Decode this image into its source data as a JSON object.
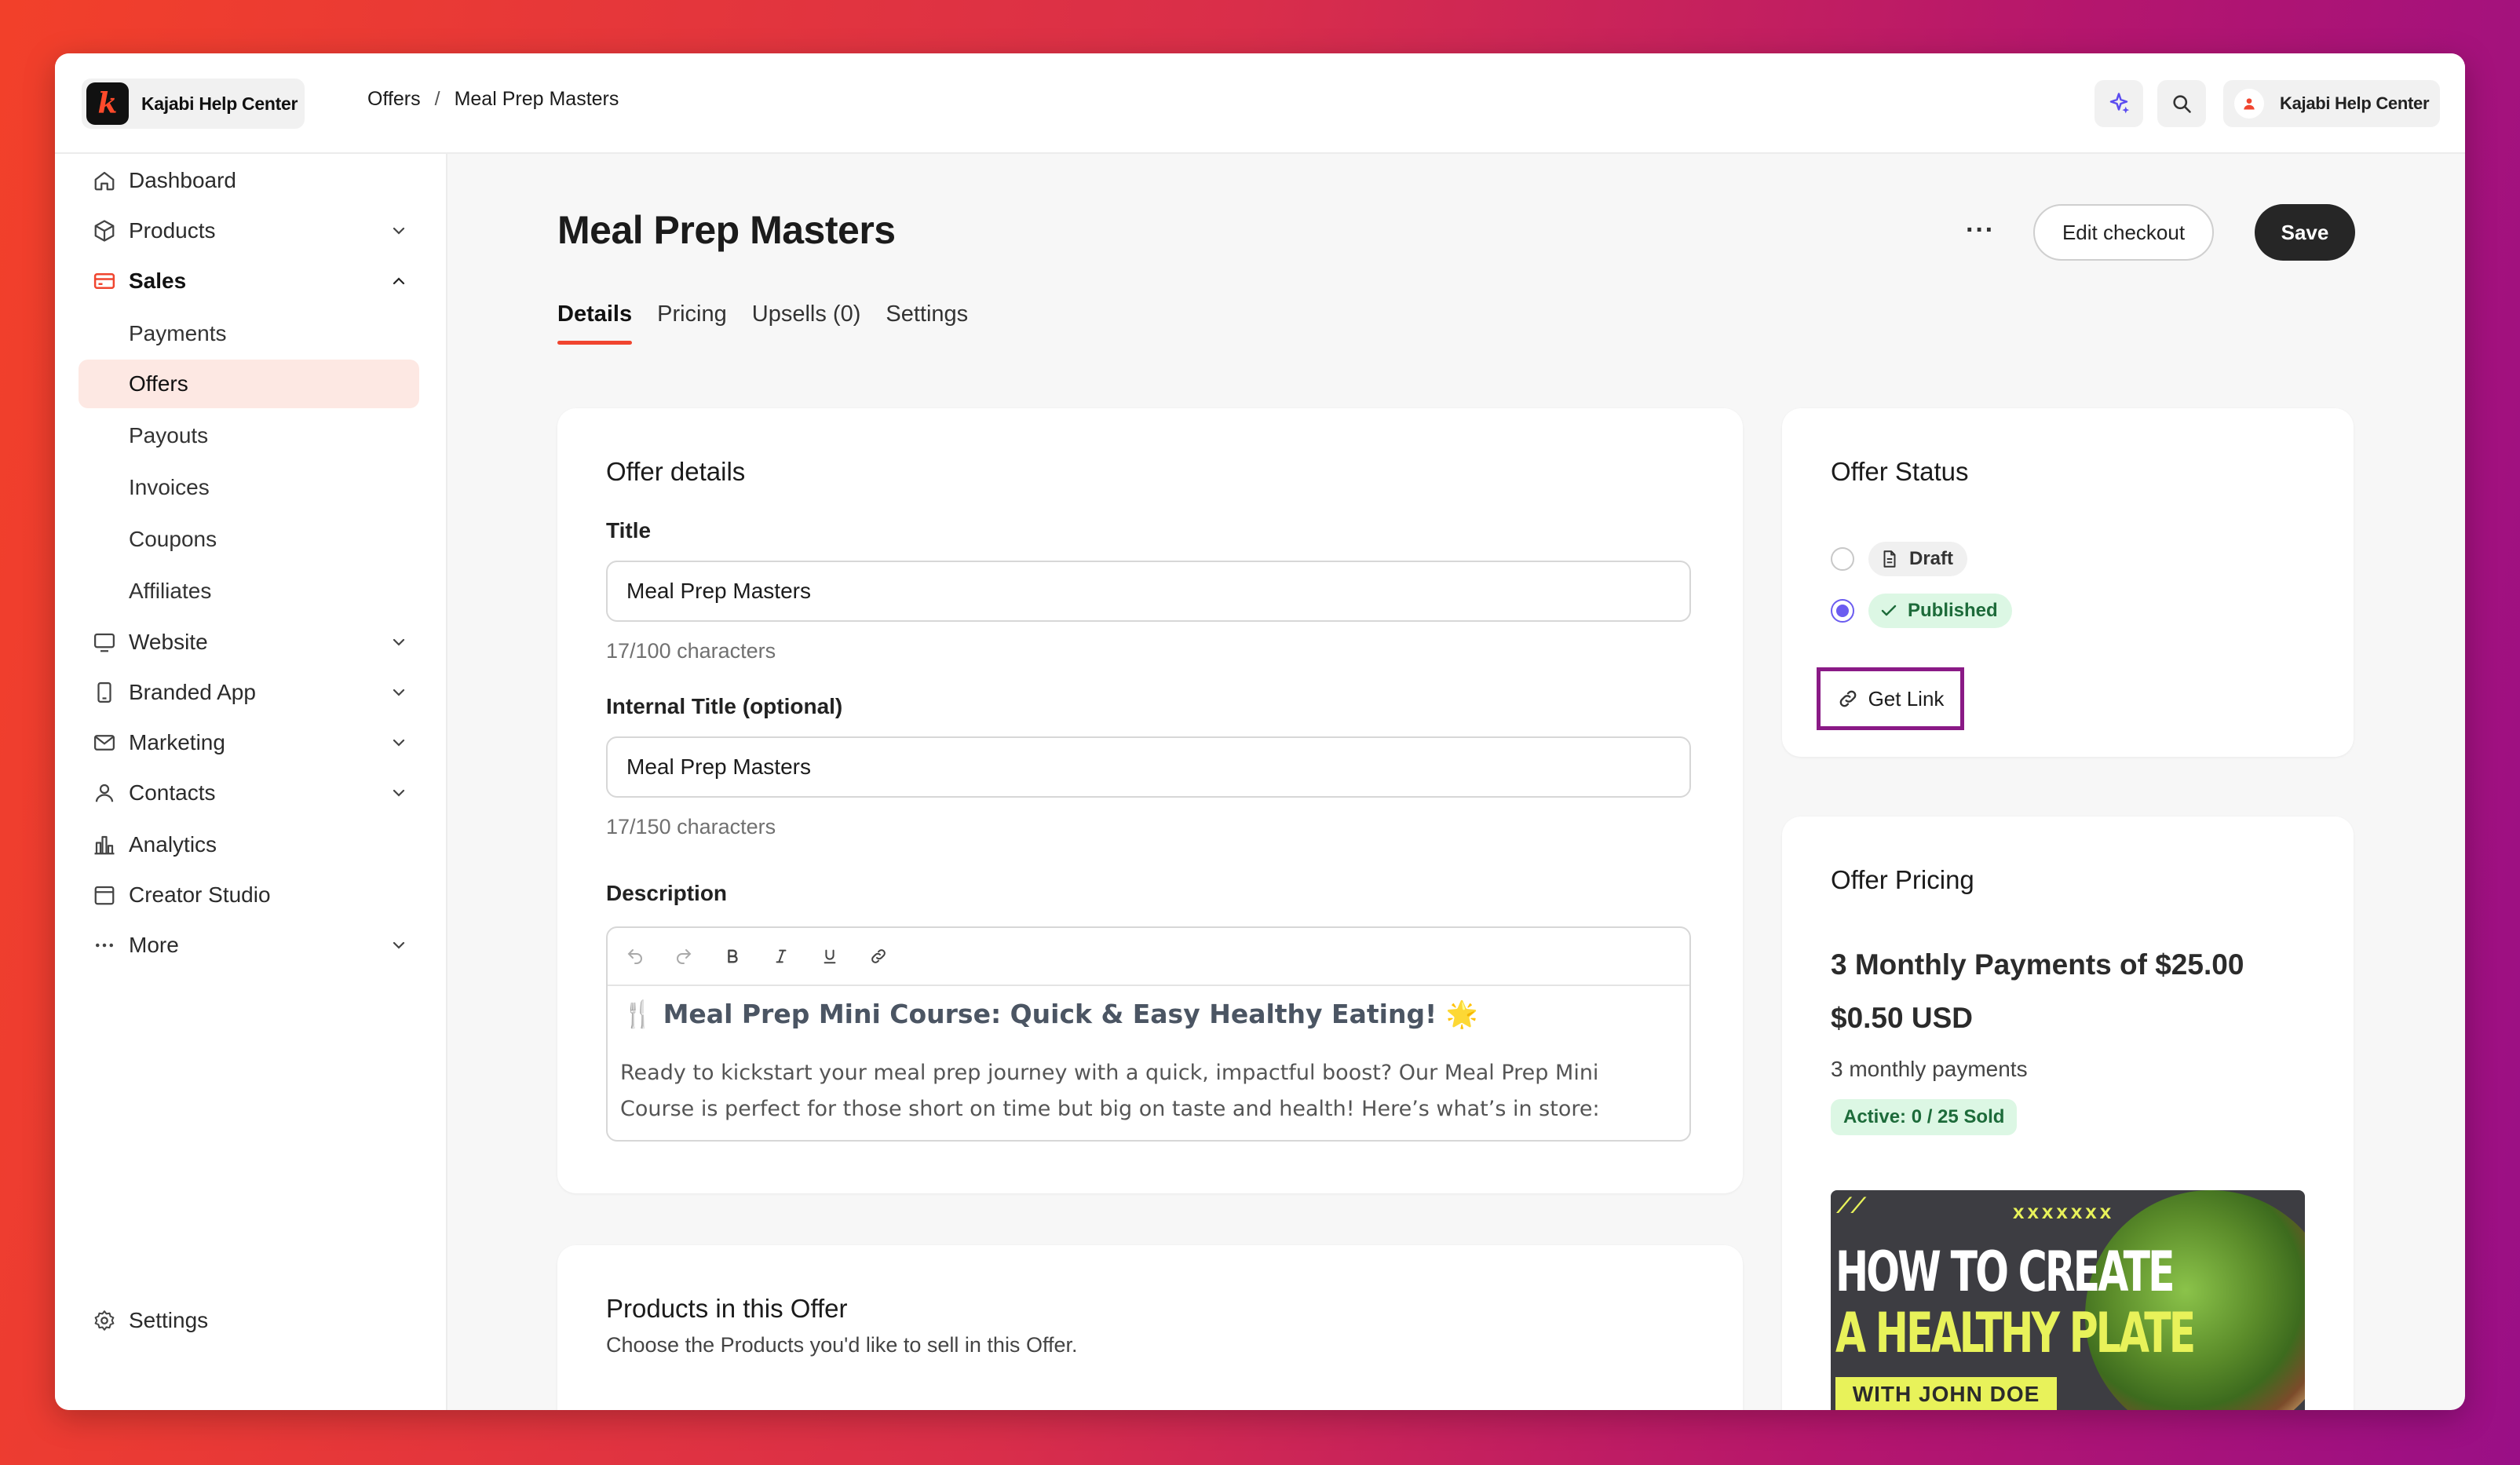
{
  "brand": {
    "name": "Kajabi Help Center",
    "logo_letter": "k"
  },
  "breadcrumb": {
    "items": [
      "Offers",
      "Meal Prep Masters"
    ],
    "separator": "/"
  },
  "user": {
    "name": "Kajabi Help Center"
  },
  "sidebar": {
    "items": [
      {
        "label": "Dashboard",
        "icon": "home-icon"
      },
      {
        "label": "Products",
        "icon": "box-icon"
      },
      {
        "label": "Sales",
        "icon": "card-icon"
      },
      {
        "label": "Payments"
      },
      {
        "label": "Offers"
      },
      {
        "label": "Payouts"
      },
      {
        "label": "Invoices"
      },
      {
        "label": "Coupons"
      },
      {
        "label": "Affiliates"
      },
      {
        "label": "Website",
        "icon": "monitor-icon"
      },
      {
        "label": "Branded App",
        "icon": "phone-icon"
      },
      {
        "label": "Marketing",
        "icon": "mail-icon"
      },
      {
        "label": "Contacts",
        "icon": "person-icon"
      },
      {
        "label": "Analytics",
        "icon": "bar-chart-icon"
      },
      {
        "label": "Creator Studio",
        "icon": "calendar-icon"
      },
      {
        "label": "More",
        "icon": "dots-icon"
      }
    ],
    "settings_label": "Settings"
  },
  "page": {
    "title": "Meal Prep Masters",
    "more_label": "···",
    "edit_checkout_label": "Edit checkout",
    "save_label": "Save",
    "tabs": [
      "Details",
      "Pricing",
      "Upsells (0)",
      "Settings"
    ]
  },
  "offer_details": {
    "heading": "Offer details",
    "title_label": "Title",
    "title_value": "Meal Prep Masters",
    "title_count": "17/100 characters",
    "internal_title_label": "Internal Title (optional)",
    "internal_title_value": "Meal Prep Masters",
    "internal_title_count": "17/150 characters",
    "description_label": "Description",
    "description_heading": "🍴 Meal Prep Mini Course: Quick & Easy Healthy Eating! 🌟",
    "description_body": "Ready to kickstart your meal prep journey with a quick, impactful boost? Our Meal Prep Mini Course is perfect for those short on time but big on taste and health! Here’s what’s in store:"
  },
  "products_card": {
    "heading": "Products in this Offer",
    "subtitle": "Choose the Products you'd like to sell in this Offer."
  },
  "offer_status": {
    "heading": "Offer Status",
    "draft_label": "Draft",
    "published_label": "Published",
    "selected": "Published",
    "get_link_label": "Get Link"
  },
  "offer_pricing": {
    "heading": "Offer Pricing",
    "price_line1": "3 Monthly Payments of $25.00",
    "price_line2": "$0.50 USD",
    "price_sub": "3 monthly payments",
    "sold_badge": "Active: 0 / 25 Sold"
  },
  "thumbnail": {
    "stars": "xxxxxxx",
    "line1": "HOW TO CREATE",
    "line2": "A HEALTHY PLATE",
    "line3": "WITH JOHN DOE"
  },
  "colors": {
    "accent": "#f0452f",
    "radio": "#6b5cf0",
    "highlight_box": "#8a1a86",
    "success_bg": "#dcf7e4",
    "success_text": "#1d6b3a"
  }
}
